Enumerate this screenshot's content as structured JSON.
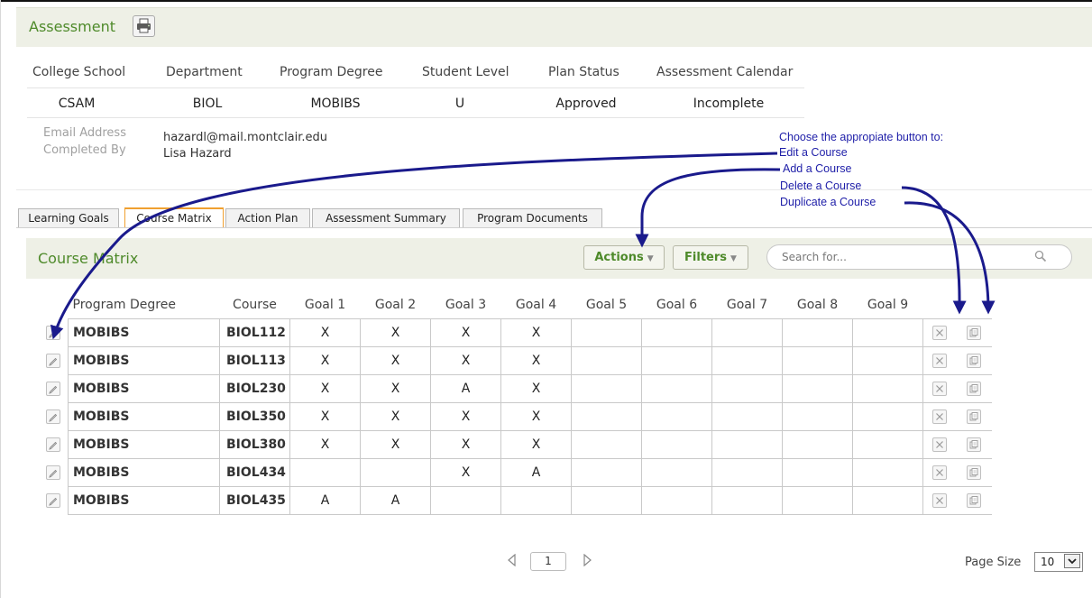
{
  "header": {
    "title": "Assessment",
    "print_icon": "printer-icon"
  },
  "info": {
    "headers": [
      "College School",
      "Department",
      "Program Degree",
      "Student Level",
      "Plan Status",
      "Assessment Calendar"
    ],
    "values": [
      "CSAM",
      "BIOL",
      "MOBIBS",
      "U",
      "Approved",
      "Incomplete"
    ],
    "email_label": "Email Address",
    "email_value": "hazardl@mail.montclair.edu",
    "completed_label": "Completed By",
    "completed_value": "Lisa Hazard"
  },
  "annotation": {
    "intro": "Choose the appropiate button to:",
    "edit": "Edit a Course",
    "add": "Add a Course",
    "delete": "Delete a Course",
    "duplicate": "Duplicate a Course"
  },
  "tabs": [
    "Learning Goals",
    "Course Matrix",
    "Action Plan",
    "Assessment Summary",
    "Program Documents"
  ],
  "active_tab": "Course Matrix",
  "course_matrix": {
    "title": "Course Matrix",
    "actions_label": "Actions",
    "filters_label": "Filters",
    "search_placeholder": "Search for...",
    "columns": [
      "Program Degree",
      "Course",
      "Goal 1",
      "Goal 2",
      "Goal 3",
      "Goal 4",
      "Goal 5",
      "Goal 6",
      "Goal 7",
      "Goal 8",
      "Goal 9"
    ],
    "rows": [
      {
        "program": "MOBIBS",
        "course": "BIOL112",
        "goals": [
          "X",
          "X",
          "X",
          "X",
          "",
          "",
          "",
          "",
          ""
        ]
      },
      {
        "program": "MOBIBS",
        "course": "BIOL113",
        "goals": [
          "X",
          "X",
          "X",
          "X",
          "",
          "",
          "",
          "",
          ""
        ]
      },
      {
        "program": "MOBIBS",
        "course": "BIOL230",
        "goals": [
          "X",
          "X",
          "A",
          "X",
          "",
          "",
          "",
          "",
          ""
        ]
      },
      {
        "program": "MOBIBS",
        "course": "BIOL350",
        "goals": [
          "X",
          "X",
          "X",
          "X",
          "",
          "",
          "",
          "",
          ""
        ]
      },
      {
        "program": "MOBIBS",
        "course": "BIOL380",
        "goals": [
          "X",
          "X",
          "X",
          "X",
          "",
          "",
          "",
          "",
          ""
        ]
      },
      {
        "program": "MOBIBS",
        "course": "BIOL434",
        "goals": [
          "",
          "",
          "X",
          "A",
          "",
          "",
          "",
          "",
          ""
        ]
      },
      {
        "program": "MOBIBS",
        "course": "BIOL435",
        "goals": [
          "A",
          "A",
          "",
          "",
          "",
          "",
          "",
          "",
          ""
        ]
      }
    ]
  },
  "pager": {
    "page": "1",
    "page_size_label": "Page Size",
    "page_size": "10"
  },
  "colors": {
    "accent_green": "#4e8a2a",
    "annotation_blue": "#1e1ea8",
    "active_tab": "#f0a030"
  }
}
